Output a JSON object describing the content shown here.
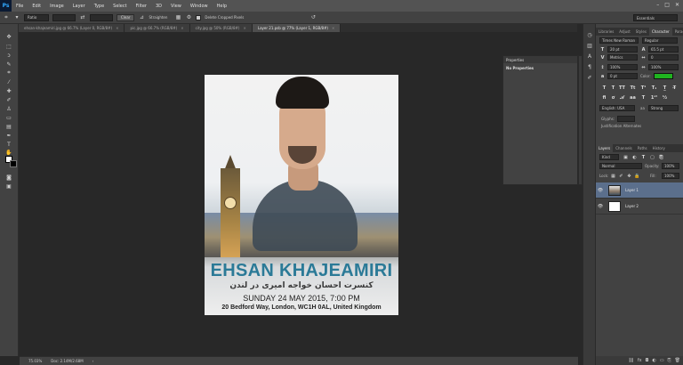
{
  "app": {
    "logo": "Ps"
  },
  "menu": [
    "File",
    "Edit",
    "Image",
    "Layer",
    "Type",
    "Select",
    "Filter",
    "3D",
    "View",
    "Window",
    "Help"
  ],
  "options_bar": {
    "ratio_select": "Ratio",
    "clear_label": "Clear",
    "straighten_label": "Straighten",
    "delete_cropped_label": "Delete Cropped Pixels",
    "workspace": "Essentials"
  },
  "doc_tabs": [
    {
      "label": "ehsan-khajeamiri.jpg @ 66.7% (Layer 0, RGB/8#)"
    },
    {
      "label": "pic.jpg @ 66.7% (RGB/8#)"
    },
    {
      "label": "city.jpg @ 50% (RGB/8#)"
    },
    {
      "label": "Layer 21.psb @ 77% (Layer 1, RGB/8#)"
    }
  ],
  "poster": {
    "title": "EHSAN KHAJEAMIRI",
    "persian": "کنسرت احسان خواجه امیری در لندن",
    "date": "SUNDAY 24 MAY 2015, 7:00 PM",
    "address": "20 Bedford Way, London, WC1H 0AL, United Kingdom"
  },
  "properties": {
    "title": "Properties",
    "message": "No Properties"
  },
  "status": {
    "zoom": "75.03%",
    "doc": "Doc: 2.14M/2.68M"
  },
  "top_panel": {
    "tabs": [
      "Libraries",
      "Adjust",
      "Styles",
      "Character",
      "Paragraph"
    ],
    "active_tab": "Character",
    "font_family": "Times New Roman",
    "font_style": "Regular",
    "font_size": "20 pt",
    "leading": "65.5 pt",
    "kerning": "Metrics",
    "tracking": "0",
    "vscale": "100%",
    "hscale": "100%",
    "baseline": "0 pt",
    "color_label": "Color:",
    "color": "#1fb31f",
    "language": "English: USA",
    "aa_label": "aa",
    "aa_value": "Strong",
    "glyphs_label": "Glyphs:",
    "justification_label": "Justification Alternates"
  },
  "layers_panel": {
    "tabs": [
      "Layers",
      "Channels",
      "Paths",
      "History"
    ],
    "active_tab": "Layers",
    "kind": "Kind",
    "blend": "Normal",
    "opacity_label": "Opacity:",
    "opacity": "100%",
    "lock_label": "Lock:",
    "fill_label": "Fill:",
    "fill": "100%",
    "layers": [
      {
        "name": "Layer 1",
        "selected": true
      },
      {
        "name": "Layer 2",
        "selected": false
      }
    ]
  }
}
